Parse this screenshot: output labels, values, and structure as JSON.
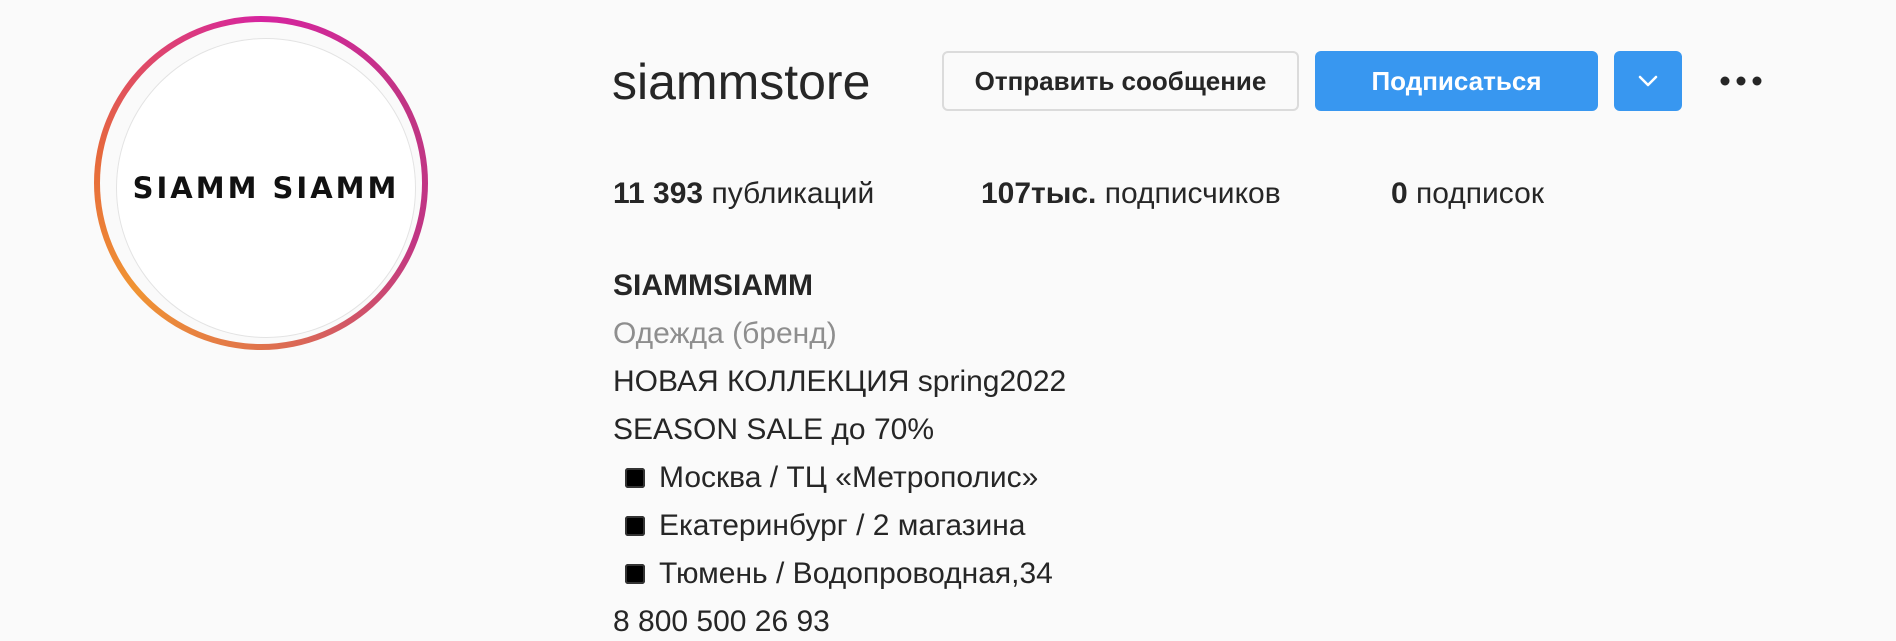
{
  "profile": {
    "avatar_text": "SIAMM SIAMM",
    "username": "siammstore",
    "message_button": "Отправить сообщение",
    "follow_button": "Подписаться",
    "dropdown_icon": "chevron-down-icon",
    "more_icon": "more-horizontal-icon"
  },
  "stats": {
    "posts_count": "11 393",
    "posts_label": "публикаций",
    "followers_count": "107тыс.",
    "followers_label": "подписчиков",
    "following_count": "0",
    "following_label": "подписок"
  },
  "bio": {
    "name": "SIAMMSIAMM",
    "category": "Одежда (бренд)",
    "lines": [
      "НОВАЯ КОЛЛЕКЦИЯ spring2022",
      "SEASON SALE до 70%"
    ],
    "locations": [
      "Москва / ТЦ «Метрополис»",
      "Екатеринбург / 2 магазина",
      "Тюмень / Водопроводная,34"
    ],
    "phone": "8 800 500 26 93"
  },
  "colors": {
    "accent": "#3897f0",
    "muted": "#8e8e8e",
    "text": "#262626",
    "background": "#fafafa"
  }
}
